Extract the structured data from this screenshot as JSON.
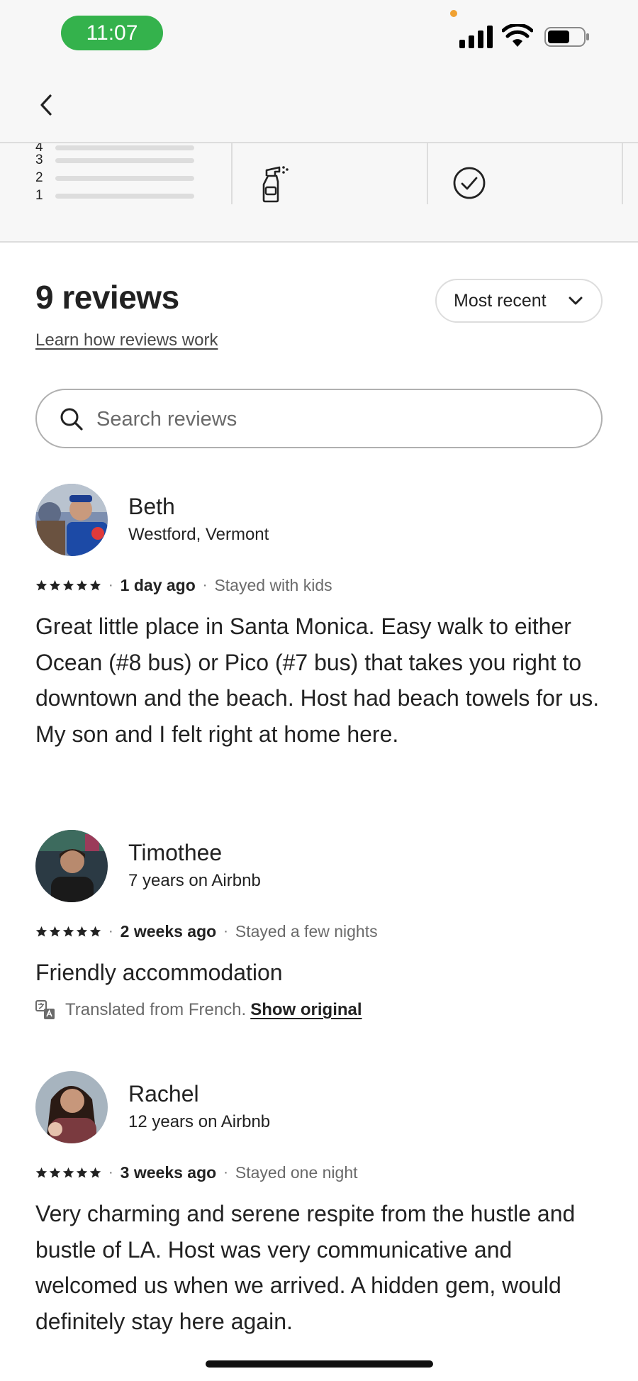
{
  "status_bar": {
    "time": "11:07",
    "icons": [
      "signal-icon",
      "wifi-icon",
      "battery-icon"
    ]
  },
  "header": {
    "back_icon": "chevron-left-icon"
  },
  "rating_breakdown": {
    "rows": [
      "4",
      "3",
      "2",
      "1"
    ],
    "category_icons": [
      "spray-bottle-icon",
      "check-circle-icon"
    ]
  },
  "reviews_header": {
    "title": "9 reviews",
    "learn_link": "Learn how reviews work",
    "sort_label": "Most recent"
  },
  "search": {
    "placeholder": "Search reviews"
  },
  "reviews": [
    {
      "name": "Beth",
      "subtitle": "Westford, Vermont",
      "stars": 5,
      "date": "1 day ago",
      "stay": "Stayed with kids",
      "text": "Great little place in Santa Monica. Easy walk to either Ocean (#8 bus) or Pico (#7 bus) that takes you right to downtown and the beach. Host had beach towels for us.\nMy son and I felt right at home here."
    },
    {
      "name": "Timothee",
      "subtitle": "7 years on Airbnb",
      "stars": 5,
      "date": "2 weeks ago",
      "stay": "Stayed a few nights",
      "text": "Friendly accommodation",
      "translated_note": "Translated from French.",
      "show_original": "Show original"
    },
    {
      "name": "Rachel",
      "subtitle": "12 years on Airbnb",
      "stars": 5,
      "date": "3 weeks ago",
      "stay": "Stayed one night",
      "text": "Very charming and serene respite from the hustle and bustle of LA. Host was very communicative and welcomed us when we arrived. A hidden gem, would definitely stay here again."
    }
  ],
  "colors": {
    "status_pill": "#34b24c",
    "text_primary": "#222222",
    "text_secondary": "#6a6a6a",
    "divider": "#dddddd",
    "header_bg": "#f7f7f7"
  }
}
